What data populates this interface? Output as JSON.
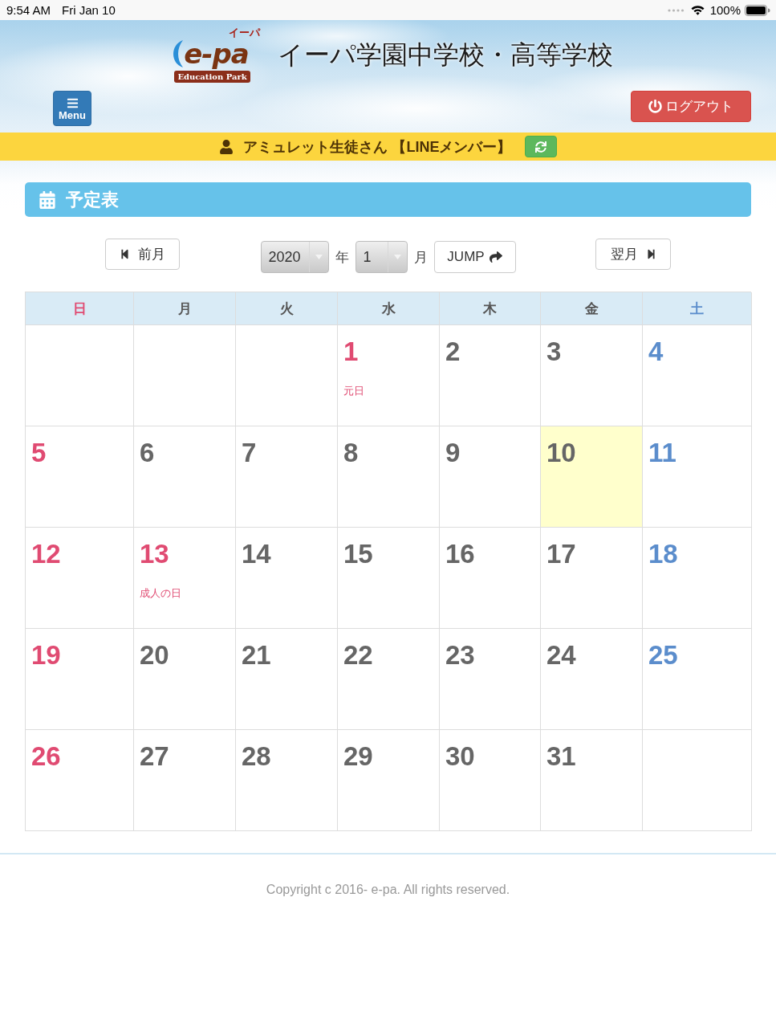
{
  "status_bar": {
    "time": "9:54 AM",
    "date": "Fri Jan 10",
    "battery": "100%"
  },
  "header": {
    "logo": {
      "mark": "e-pa",
      "kana": "イーパ",
      "subtitle": "Education Park"
    },
    "title": "イーパ学園中学校・高等学校",
    "menu_button": "Menu",
    "logout_button": "ログアウト"
  },
  "user_bar": {
    "name": "アミュレット生徒さん 【LINEメンバー】"
  },
  "schedule": {
    "title": "予定表",
    "nav": {
      "prev": "前月",
      "year": "2020",
      "year_unit": "年",
      "month": "1",
      "month_unit": "月",
      "jump": "JUMP",
      "next": "翌月"
    },
    "weekdays": [
      {
        "label": "日",
        "kind": "sunday"
      },
      {
        "label": "月",
        "kind": "weekday"
      },
      {
        "label": "火",
        "kind": "weekday"
      },
      {
        "label": "水",
        "kind": "weekday"
      },
      {
        "label": "木",
        "kind": "weekday"
      },
      {
        "label": "金",
        "kind": "weekday"
      },
      {
        "label": "土",
        "kind": "saturday"
      }
    ],
    "weeks": [
      {
        "days": [
          {
            "kind": "empty",
            "today": false
          },
          {
            "kind": "empty",
            "today": false
          },
          {
            "kind": "empty",
            "today": false
          },
          {
            "day": "1",
            "kind": "holiday",
            "event": "元日",
            "today": false
          },
          {
            "day": "2",
            "kind": "weekday",
            "today": false
          },
          {
            "day": "3",
            "kind": "weekday",
            "today": false
          },
          {
            "day": "4",
            "kind": "saturday",
            "today": false
          }
        ]
      },
      {
        "days": [
          {
            "day": "5",
            "kind": "sunday",
            "today": false
          },
          {
            "day": "6",
            "kind": "weekday",
            "today": false
          },
          {
            "day": "7",
            "kind": "weekday",
            "today": false
          },
          {
            "day": "8",
            "kind": "weekday",
            "today": false
          },
          {
            "day": "9",
            "kind": "weekday",
            "today": false
          },
          {
            "day": "10",
            "kind": "weekday",
            "today": true
          },
          {
            "day": "11",
            "kind": "saturday",
            "today": false
          }
        ]
      },
      {
        "days": [
          {
            "day": "12",
            "kind": "sunday",
            "today": false
          },
          {
            "day": "13",
            "kind": "holiday",
            "event": "成人の日",
            "today": false
          },
          {
            "day": "14",
            "kind": "weekday",
            "today": false
          },
          {
            "day": "15",
            "kind": "weekday",
            "today": false
          },
          {
            "day": "16",
            "kind": "weekday",
            "today": false
          },
          {
            "day": "17",
            "kind": "weekday",
            "today": false
          },
          {
            "day": "18",
            "kind": "saturday",
            "today": false
          }
        ]
      },
      {
        "days": [
          {
            "day": "19",
            "kind": "sunday",
            "today": false
          },
          {
            "day": "20",
            "kind": "weekday",
            "today": false
          },
          {
            "day": "21",
            "kind": "weekday",
            "today": false
          },
          {
            "day": "22",
            "kind": "weekday",
            "today": false
          },
          {
            "day": "23",
            "kind": "weekday",
            "today": false
          },
          {
            "day": "24",
            "kind": "weekday",
            "today": false
          },
          {
            "day": "25",
            "kind": "saturday",
            "today": false
          }
        ]
      },
      {
        "days": [
          {
            "day": "26",
            "kind": "sunday",
            "today": false
          },
          {
            "day": "27",
            "kind": "weekday",
            "today": false
          },
          {
            "day": "28",
            "kind": "weekday",
            "today": false
          },
          {
            "day": "29",
            "kind": "weekday",
            "today": false
          },
          {
            "day": "30",
            "kind": "weekday",
            "today": false
          },
          {
            "day": "31",
            "kind": "weekday",
            "today": false
          },
          {
            "kind": "empty",
            "today": false
          }
        ]
      }
    ]
  },
  "footer": {
    "copyright": "Copyright c 2016- e-pa. All rights reserved."
  }
}
